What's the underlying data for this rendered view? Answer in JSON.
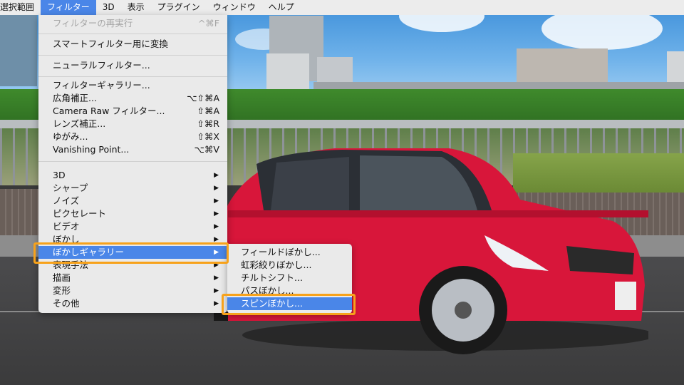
{
  "menubar": {
    "items": [
      {
        "label": "選択範囲",
        "active": false
      },
      {
        "label": "フィルター",
        "active": true
      },
      {
        "label": "3D",
        "active": false
      },
      {
        "label": "表示",
        "active": false
      },
      {
        "label": "プラグイン",
        "active": false
      },
      {
        "label": "ウィンドウ",
        "active": false
      },
      {
        "label": "ヘルプ",
        "active": false
      }
    ]
  },
  "filter_menu": {
    "items": [
      {
        "label": "フィルターの再実行",
        "shortcut": "^⌘F",
        "disabled": true
      },
      {
        "label": "スマートフィルター用に変換"
      },
      {
        "label": "ニューラルフィルター..."
      },
      {
        "label": "フィルターギャラリー..."
      },
      {
        "label": "広角補正...",
        "shortcut": "⌥⇧⌘A"
      },
      {
        "label": "Camera Raw フィルター...",
        "shortcut": "⇧⌘A"
      },
      {
        "label": "レンズ補正...",
        "shortcut": "⇧⌘R"
      },
      {
        "label": "ゆがみ...",
        "shortcut": "⇧⌘X"
      },
      {
        "label": "Vanishing Point...",
        "shortcut": "⌥⌘V"
      },
      {
        "label": "3D",
        "submenu": true
      },
      {
        "label": "シャープ",
        "submenu": true
      },
      {
        "label": "ノイズ",
        "submenu": true
      },
      {
        "label": "ピクセレート",
        "submenu": true
      },
      {
        "label": "ビデオ",
        "submenu": true
      },
      {
        "label": "ぼかし",
        "submenu": true
      },
      {
        "label": "ぼかしギャラリー",
        "submenu": true,
        "highlighted": true
      },
      {
        "label": "表現手法",
        "submenu": true
      },
      {
        "label": "描画",
        "submenu": true
      },
      {
        "label": "変形",
        "submenu": true
      },
      {
        "label": "その他",
        "submenu": true
      }
    ]
  },
  "blur_gallery_submenu": {
    "items": [
      {
        "label": "フィールドぼかし..."
      },
      {
        "label": "虹彩絞りぼかし..."
      },
      {
        "label": "チルトシフト..."
      },
      {
        "label": "パスぼかし..."
      },
      {
        "label": "スピンぼかし...",
        "highlighted": true
      }
    ]
  },
  "icons": {
    "submenu_arrow": "▶"
  },
  "colors": {
    "highlight": "#4a86e8",
    "callout": "#f7a21b",
    "car": "#d8163a"
  }
}
